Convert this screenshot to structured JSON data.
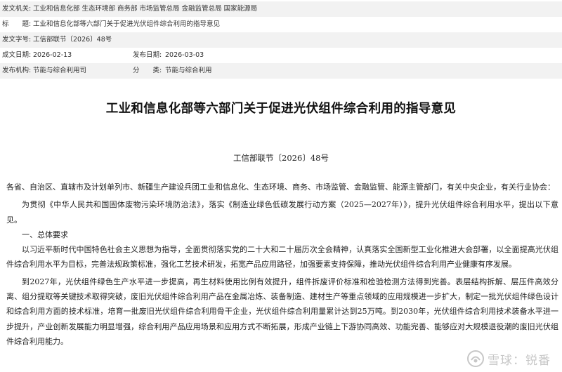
{
  "metadata": {
    "issuer_label": "发文机关:",
    "issuer_value": "工业和信息化部 生态环境部 商务部 市场监管总局 金融监管总局 国家能源局",
    "title_label": "标　　题:",
    "title_value": "工业和信息化部等六部门关于促进光伏组件综合利用的指导意见",
    "docno_label": "发文字号:",
    "docno_value": "工信部联节〔2026〕48号",
    "written_label": "成文日期:",
    "written_value": "2026-02-13",
    "published_label": "发布日期:",
    "published_value": "2026-03-03",
    "org_label": "发布机构:",
    "org_value": "节能与综合利用司",
    "category_label": "分　　类:",
    "category_value": "节能与综合利用"
  },
  "document": {
    "title": "工业和信息化部等六部门关于促进光伏组件综合利用的指导意见",
    "doc_number": "工信部联节〔2026〕48号",
    "addressee": "各省、自治区、直辖市及计划单列市、新疆生产建设兵团工业和信息化、生态环境、商务、市场监管、金融监管、能源主管部门，有关中央企业，有关行业协会：",
    "intro": "为贯彻《中华人民共和国固体废物污染环境防治法》，落实《制造业绿色低碳发展行动方案（2025—2027年）》，提升光伏组件综合利用水平，提出以下意见。",
    "section1_heading": "一、总体要求",
    "section1_para1": "以习近平新时代中国特色社会主义思想为指导，全面贯彻落实党的二十大和二十届历次全会精神，认真落实全国新型工业化推进大会部署，以全面提高光伏组件综合利用水平为目标，完善法规政策标准，强化工艺技术研发，拓宽产品应用路径，加强要素支持保障，推动光伏组件综合利用产业健康有序发展。",
    "section1_para2": "到2027年，光伏组件绿色生产水平进一步提高，再生材料使用比例有效提升，组件拆废评价标准和检验检测方法得到完善。表层结构拆解、层压件高效分离、组分提取等关键技术取得突破，废旧光伏组件综合利用产品在金属冶炼、装备制造、建材生产等重点领域的应用规模进一步扩大，制定一批光伏组件绿色设计和综合利用方面的技术标准，培育一批废旧光伏组件综合利用骨干企业，光伏组件综合利用量累计达到25万吨。到2030年，光伏组件综合利用技术装备水平进一步提升，产业创新发展能力明显增强，综合利用产品应用场景和应用方式不断拓展，形成产业链上下游协同高效、功能完善、能够应对大规模退役潮的废旧光伏组件综合利用能力。"
  },
  "watermark": {
    "text": "雪球：锐番",
    "icon": "snowball-logo-icon"
  }
}
